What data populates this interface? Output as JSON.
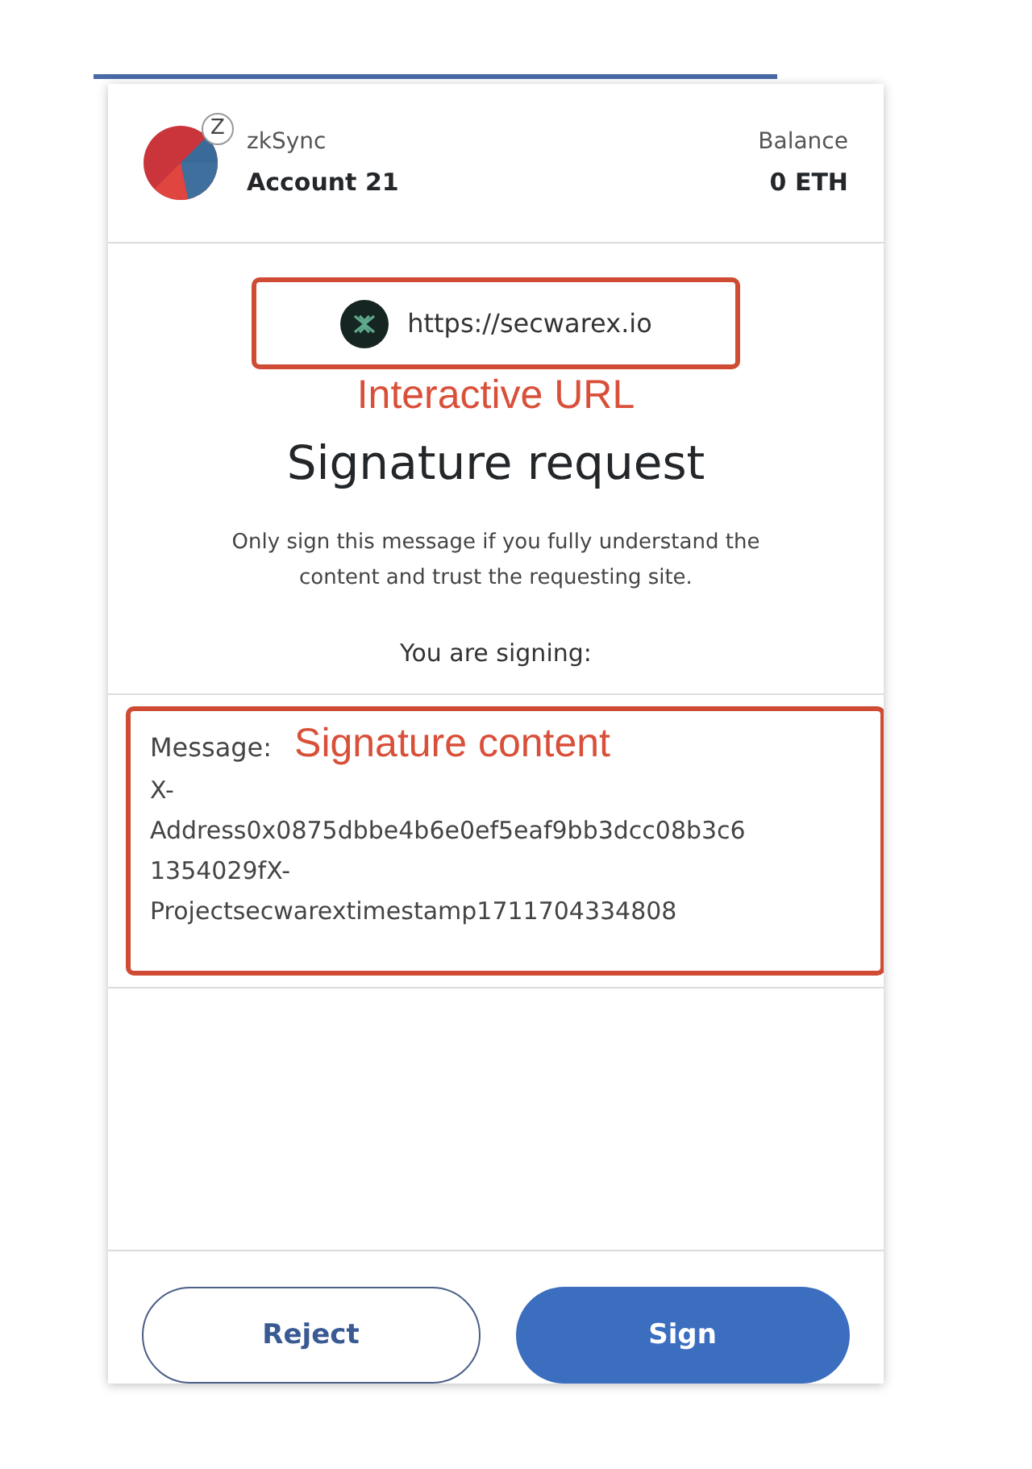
{
  "account": {
    "network": "zkSync",
    "badge": "Z",
    "name": "Account 21",
    "balance_label": "Balance",
    "balance": "0 ETH"
  },
  "origin": {
    "url": "https://secwarex.io",
    "annotation": "Interactive URL"
  },
  "title": "Signature request",
  "description": "Only sign this message if you fully understand the content and trust the requesting site.",
  "signing_label": "You are signing:",
  "message": {
    "label": "Message:",
    "annotation": "Signature content",
    "value": "X-Address0x0875dbbe4b6e0ef5eaf9bb3dcc08b3c61354029fX-Projectsecwarextimestamp1711704334808"
  },
  "buttons": [
    {
      "label": "Reject",
      "kind": "secondary"
    },
    {
      "label": "Sign",
      "kind": "primary"
    }
  ]
}
